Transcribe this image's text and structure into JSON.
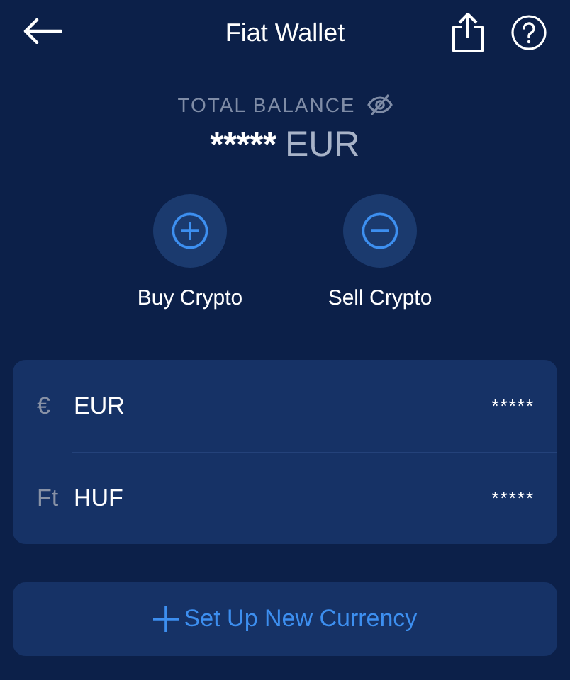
{
  "header": {
    "title": "Fiat Wallet"
  },
  "balance": {
    "label": "TOTAL BALANCE",
    "amount": "*****",
    "currency": "EUR"
  },
  "actions": [
    {
      "kind": "plus",
      "label": "Buy Crypto"
    },
    {
      "kind": "minus",
      "label": "Sell Crypto"
    }
  ],
  "currencies": [
    {
      "symbol": "€",
      "code": "EUR",
      "amount": "*****"
    },
    {
      "symbol": "Ft",
      "code": "HUF",
      "amount": "*****"
    }
  ],
  "add_button": {
    "label": "Set Up New Currency"
  }
}
